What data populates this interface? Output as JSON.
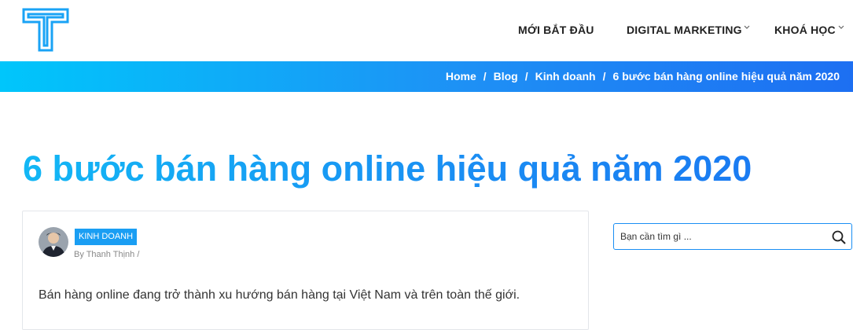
{
  "nav": {
    "items": [
      {
        "label": "MỚI BẮT ĐẦU"
      },
      {
        "label": "DIGITAL MARKETING"
      },
      {
        "label": "KHOÁ HỌC"
      }
    ]
  },
  "breadcrumb": {
    "home": "Home",
    "sep": "/",
    "blog": "Blog",
    "category": "Kinh doanh",
    "current": "6 bước bán hàng online hiệu quả năm 2020"
  },
  "post": {
    "title": "6 bước bán hàng online hiệu quả năm 2020",
    "category": "KINH DOANH",
    "byline": "By Thanh Thịnh /",
    "lead": "Bán hàng online đang trở thành xu hướng bán hàng tại Việt Nam và trên toàn thế giới."
  },
  "search": {
    "placeholder": "Bạn cần tìm gì ..."
  },
  "colors": {
    "accent": "#1a8ef3",
    "breadcrumb_start": "#00c6fb",
    "breadcrumb_end": "#1d6ff2"
  }
}
